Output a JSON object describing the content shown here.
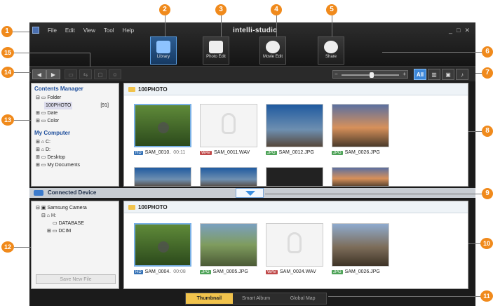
{
  "app": {
    "menu": [
      "File",
      "Edit",
      "View",
      "Tool",
      "Help"
    ],
    "brand": "intelli-studio",
    "modes": [
      {
        "label": "Library",
        "icon": "library-icon"
      },
      {
        "label": "Photo Edit",
        "icon": "photo-edit-icon"
      },
      {
        "label": "Movie Edit",
        "icon": "movie-edit-icon"
      },
      {
        "label": "Share",
        "icon": "share-icon"
      }
    ]
  },
  "filters": {
    "all": "All"
  },
  "left_top": {
    "title": "Contents Manager",
    "folder": "Folder",
    "folder_100photo": "100PHOTO",
    "folder_count": "[91]",
    "date": "Date",
    "color": "Color",
    "my_computer": "My Computer",
    "c_drive": "C:",
    "d_drive": "D:",
    "desktop": "Desktop",
    "my_documents": "My Documents"
  },
  "top_grid": {
    "folder": "100PHOTO",
    "items": [
      {
        "badge": "HD",
        "name": "SAM_0010.",
        "duration": "00:11"
      },
      {
        "badge": "WAV",
        "name": "SAM_0011.WAV",
        "duration": ""
      },
      {
        "badge": "JPG",
        "name": "SAM_0012.JPG",
        "duration": ""
      },
      {
        "badge": "JPG",
        "name": "SAM_0026.JPG",
        "duration": ""
      }
    ]
  },
  "device": {
    "title": "Connected Device",
    "camera": "Samsung Camera",
    "drive": "H:",
    "database": "DATABASE",
    "dcim": "DCIM",
    "save_new_file": "Save New File"
  },
  "bottom_grid": {
    "folder": "100PHOTO",
    "items": [
      {
        "badge": "HD",
        "name": "SAM_0004.",
        "duration": "00:08"
      },
      {
        "badge": "JPG",
        "name": "SAM_0005.JPG",
        "duration": ""
      },
      {
        "badge": "WAV",
        "name": "SAM_0024.WAV",
        "duration": ""
      },
      {
        "badge": "JPG",
        "name": "SAM_0026.JPG",
        "duration": ""
      }
    ]
  },
  "view_tabs": [
    "Thumbnail",
    "Smart Album",
    "Global Map"
  ],
  "callouts": [
    "1",
    "2",
    "3",
    "4",
    "5",
    "6",
    "7",
    "8",
    "9",
    "10",
    "11",
    "12",
    "13",
    "14",
    "15"
  ],
  "colors": {
    "callout": "#f08a1c",
    "accent": "#3c86d8"
  }
}
